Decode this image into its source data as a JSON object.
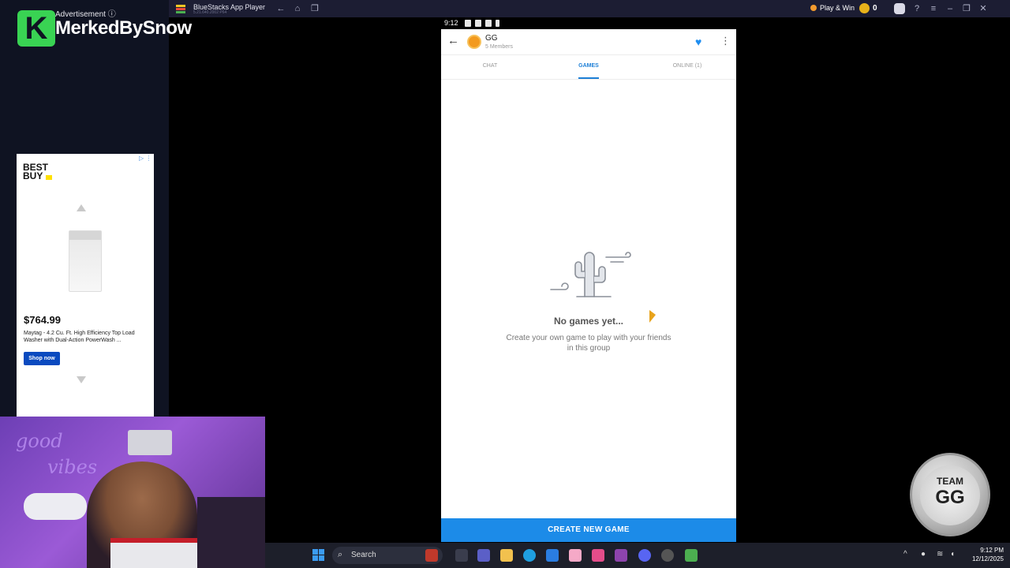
{
  "bluestacks": {
    "app_title": "BlueStacks App Player",
    "version": "5.21.640.2002 P64",
    "play_win_label": "Play & Win",
    "coin_count": "0"
  },
  "overlay": {
    "channel_name": "MerkedBySnow",
    "logo_letter": "K",
    "ad_label": "Advertisement ⓘ"
  },
  "ad": {
    "brand_line1": "BEST",
    "brand_line2": "BUY",
    "price": "$764.99",
    "description": "Maytag - 4.2 Cu. Ft. High Efficiency Top Load Washer with Dual-Action PowerWash ...",
    "cta": "Shop now"
  },
  "webcam": {
    "neon_line1": "good",
    "neon_line2": "vibes"
  },
  "android": {
    "status_time": "9:12",
    "group_name": "GG",
    "group_members": "5 Members",
    "tabs": [
      "CHAT",
      "GAMES",
      "ONLINE (1)"
    ],
    "active_tab": "GAMES",
    "empty_title": "No games yet...",
    "empty_subtitle": "Create your own game to play with your friends in this group",
    "create_button": "CREATE NEW GAME",
    "accent_color": "#1c8be8"
  },
  "badge": {
    "line1": "TEAM",
    "line2": "GG"
  },
  "taskbar": {
    "search_label": "Search",
    "time": "9:12 PM",
    "date": "12/12/2025"
  },
  "icons": [
    "windows-start-icon",
    "search-icon",
    "back-arrow-icon",
    "heart-icon",
    "more-vertical-icon",
    "cactus-empty-state-icon"
  ]
}
